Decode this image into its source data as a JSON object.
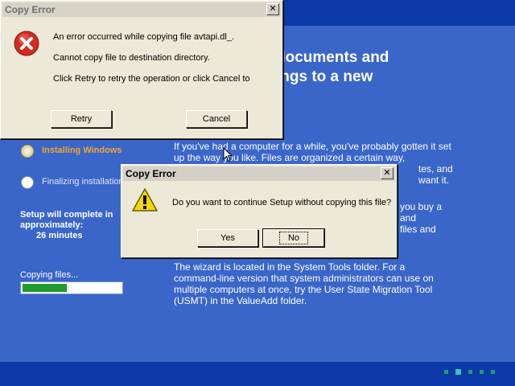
{
  "setup": {
    "heading_lines": [
      "documents and",
      "ings to a new"
    ],
    "paragraphs": [
      "If you've had a computer for a while, you've probably gotten it set up the way you like. Files are organized a certain way,",
      "tes, and",
      "want it.",
      "you buy a",
      "and",
      "files and",
      "The wizard is located in the System Tools folder. For a command-line version that system administrators can use on multiple computers at once, try the User State Migration Tool (USMT) in the ValueAdd folder."
    ],
    "steps": [
      {
        "label": "Installing Windows",
        "state": "active"
      },
      {
        "label": "Finalizing installation",
        "state": "pending"
      }
    ],
    "complete_text": "Setup will complete in approximately:",
    "complete_time": "26 minutes",
    "copying_label": "Copying files...",
    "progress_fraction": 0.45,
    "colors": {
      "background": "#3a66c9",
      "bars": "#0b3aa8",
      "active_step": "#f3a531",
      "progress": "#1e9b2a"
    }
  },
  "error_dialog": {
    "title": "Copy Error",
    "close_glyph": "✕",
    "icon": "error-icon",
    "lines": [
      "An error occurred while copying file avtapi.dl_.",
      "Cannot copy file to destination directory.",
      "Click Retry to retry the operation or click Cancel to"
    ],
    "retry_label": "Retry",
    "cancel_label": "Cancel"
  },
  "confirm_dialog": {
    "title": "Copy Error",
    "close_glyph": "✕",
    "icon": "warning-icon",
    "message": "Do you want to continue Setup without copying this file?",
    "yes_label": "Yes",
    "no_label": "No"
  }
}
